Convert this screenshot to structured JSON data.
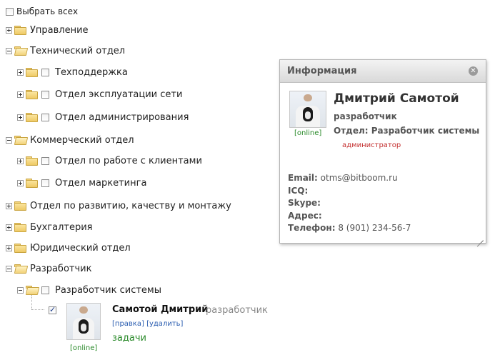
{
  "select_all_label": "Выбрать всех",
  "tree": {
    "n1": "Управление",
    "n2": "Технический отдел",
    "n2a": "Техподдержка",
    "n2b": "Отдел эксплуатации сети",
    "n2c": "Отдел администрирования",
    "n3": "Коммерческий отдел",
    "n3a": "Отдел по работе с клиентами",
    "n3b": "Отдел маркетинга",
    "n4": "Отдел по развитию, качеству и монтажу",
    "n5": "Бухгалтерия",
    "n6": "Юридический отдел",
    "n7": "Разработчик",
    "n7a": "Разработчик системы"
  },
  "employee": {
    "name": "Самотой Дмитрий",
    "position": "разработчик",
    "edit_link": "[правка]",
    "delete_link": "[удалить]",
    "tasks_link": "задачи",
    "status": "[online]",
    "checked": true
  },
  "info_panel": {
    "title": "Информация",
    "name": "Дмитрий Самотой",
    "role": "разработчик",
    "dept": "Отдел: Разработчик системы",
    "admin_badge": "администратор",
    "status": "[online]",
    "email_label": "Email:",
    "email": "otms@bitboom.ru",
    "icq_label": "ICQ:",
    "icq": "",
    "skype_label": "Skype:",
    "skype": "",
    "address_label": "Адрес:",
    "address": "",
    "phone_label": "Телефон:",
    "phone": "8 (901) 234-56-7"
  },
  "colors": {
    "online": "#2a8a2a",
    "link": "#2a5db0",
    "admin": "#c43030",
    "folder": "#eec965"
  }
}
